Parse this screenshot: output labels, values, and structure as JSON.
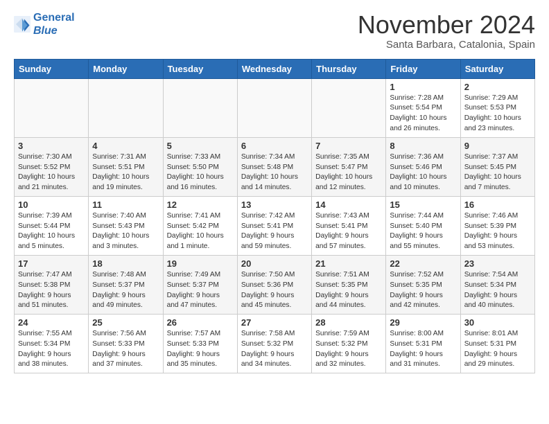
{
  "header": {
    "logo_line1": "General",
    "logo_line2": "Blue",
    "month": "November 2024",
    "location": "Santa Barbara, Catalonia, Spain"
  },
  "weekdays": [
    "Sunday",
    "Monday",
    "Tuesday",
    "Wednesday",
    "Thursday",
    "Friday",
    "Saturday"
  ],
  "rows": [
    {
      "cells": [
        {
          "empty": true
        },
        {
          "empty": true
        },
        {
          "empty": true
        },
        {
          "empty": true
        },
        {
          "empty": true
        },
        {
          "day": "1",
          "info": "Sunrise: 7:28 AM\nSunset: 5:54 PM\nDaylight: 10 hours\nand 26 minutes."
        },
        {
          "day": "2",
          "info": "Sunrise: 7:29 AM\nSunset: 5:53 PM\nDaylight: 10 hours\nand 23 minutes."
        }
      ]
    },
    {
      "cells": [
        {
          "day": "3",
          "info": "Sunrise: 7:30 AM\nSunset: 5:52 PM\nDaylight: 10 hours\nand 21 minutes."
        },
        {
          "day": "4",
          "info": "Sunrise: 7:31 AM\nSunset: 5:51 PM\nDaylight: 10 hours\nand 19 minutes."
        },
        {
          "day": "5",
          "info": "Sunrise: 7:33 AM\nSunset: 5:50 PM\nDaylight: 10 hours\nand 16 minutes."
        },
        {
          "day": "6",
          "info": "Sunrise: 7:34 AM\nSunset: 5:48 PM\nDaylight: 10 hours\nand 14 minutes."
        },
        {
          "day": "7",
          "info": "Sunrise: 7:35 AM\nSunset: 5:47 PM\nDaylight: 10 hours\nand 12 minutes."
        },
        {
          "day": "8",
          "info": "Sunrise: 7:36 AM\nSunset: 5:46 PM\nDaylight: 10 hours\nand 10 minutes."
        },
        {
          "day": "9",
          "info": "Sunrise: 7:37 AM\nSunset: 5:45 PM\nDaylight: 10 hours\nand 7 minutes."
        }
      ]
    },
    {
      "cells": [
        {
          "day": "10",
          "info": "Sunrise: 7:39 AM\nSunset: 5:44 PM\nDaylight: 10 hours\nand 5 minutes."
        },
        {
          "day": "11",
          "info": "Sunrise: 7:40 AM\nSunset: 5:43 PM\nDaylight: 10 hours\nand 3 minutes."
        },
        {
          "day": "12",
          "info": "Sunrise: 7:41 AM\nSunset: 5:42 PM\nDaylight: 10 hours\nand 1 minute."
        },
        {
          "day": "13",
          "info": "Sunrise: 7:42 AM\nSunset: 5:41 PM\nDaylight: 9 hours\nand 59 minutes."
        },
        {
          "day": "14",
          "info": "Sunrise: 7:43 AM\nSunset: 5:41 PM\nDaylight: 9 hours\nand 57 minutes."
        },
        {
          "day": "15",
          "info": "Sunrise: 7:44 AM\nSunset: 5:40 PM\nDaylight: 9 hours\nand 55 minutes."
        },
        {
          "day": "16",
          "info": "Sunrise: 7:46 AM\nSunset: 5:39 PM\nDaylight: 9 hours\nand 53 minutes."
        }
      ]
    },
    {
      "cells": [
        {
          "day": "17",
          "info": "Sunrise: 7:47 AM\nSunset: 5:38 PM\nDaylight: 9 hours\nand 51 minutes."
        },
        {
          "day": "18",
          "info": "Sunrise: 7:48 AM\nSunset: 5:37 PM\nDaylight: 9 hours\nand 49 minutes."
        },
        {
          "day": "19",
          "info": "Sunrise: 7:49 AM\nSunset: 5:37 PM\nDaylight: 9 hours\nand 47 minutes."
        },
        {
          "day": "20",
          "info": "Sunrise: 7:50 AM\nSunset: 5:36 PM\nDaylight: 9 hours\nand 45 minutes."
        },
        {
          "day": "21",
          "info": "Sunrise: 7:51 AM\nSunset: 5:35 PM\nDaylight: 9 hours\nand 44 minutes."
        },
        {
          "day": "22",
          "info": "Sunrise: 7:52 AM\nSunset: 5:35 PM\nDaylight: 9 hours\nand 42 minutes."
        },
        {
          "day": "23",
          "info": "Sunrise: 7:54 AM\nSunset: 5:34 PM\nDaylight: 9 hours\nand 40 minutes."
        }
      ]
    },
    {
      "cells": [
        {
          "day": "24",
          "info": "Sunrise: 7:55 AM\nSunset: 5:34 PM\nDaylight: 9 hours\nand 38 minutes."
        },
        {
          "day": "25",
          "info": "Sunrise: 7:56 AM\nSunset: 5:33 PM\nDaylight: 9 hours\nand 37 minutes."
        },
        {
          "day": "26",
          "info": "Sunrise: 7:57 AM\nSunset: 5:33 PM\nDaylight: 9 hours\nand 35 minutes."
        },
        {
          "day": "27",
          "info": "Sunrise: 7:58 AM\nSunset: 5:32 PM\nDaylight: 9 hours\nand 34 minutes."
        },
        {
          "day": "28",
          "info": "Sunrise: 7:59 AM\nSunset: 5:32 PM\nDaylight: 9 hours\nand 32 minutes."
        },
        {
          "day": "29",
          "info": "Sunrise: 8:00 AM\nSunset: 5:31 PM\nDaylight: 9 hours\nand 31 minutes."
        },
        {
          "day": "30",
          "info": "Sunrise: 8:01 AM\nSunset: 5:31 PM\nDaylight: 9 hours\nand 29 minutes."
        }
      ]
    }
  ]
}
